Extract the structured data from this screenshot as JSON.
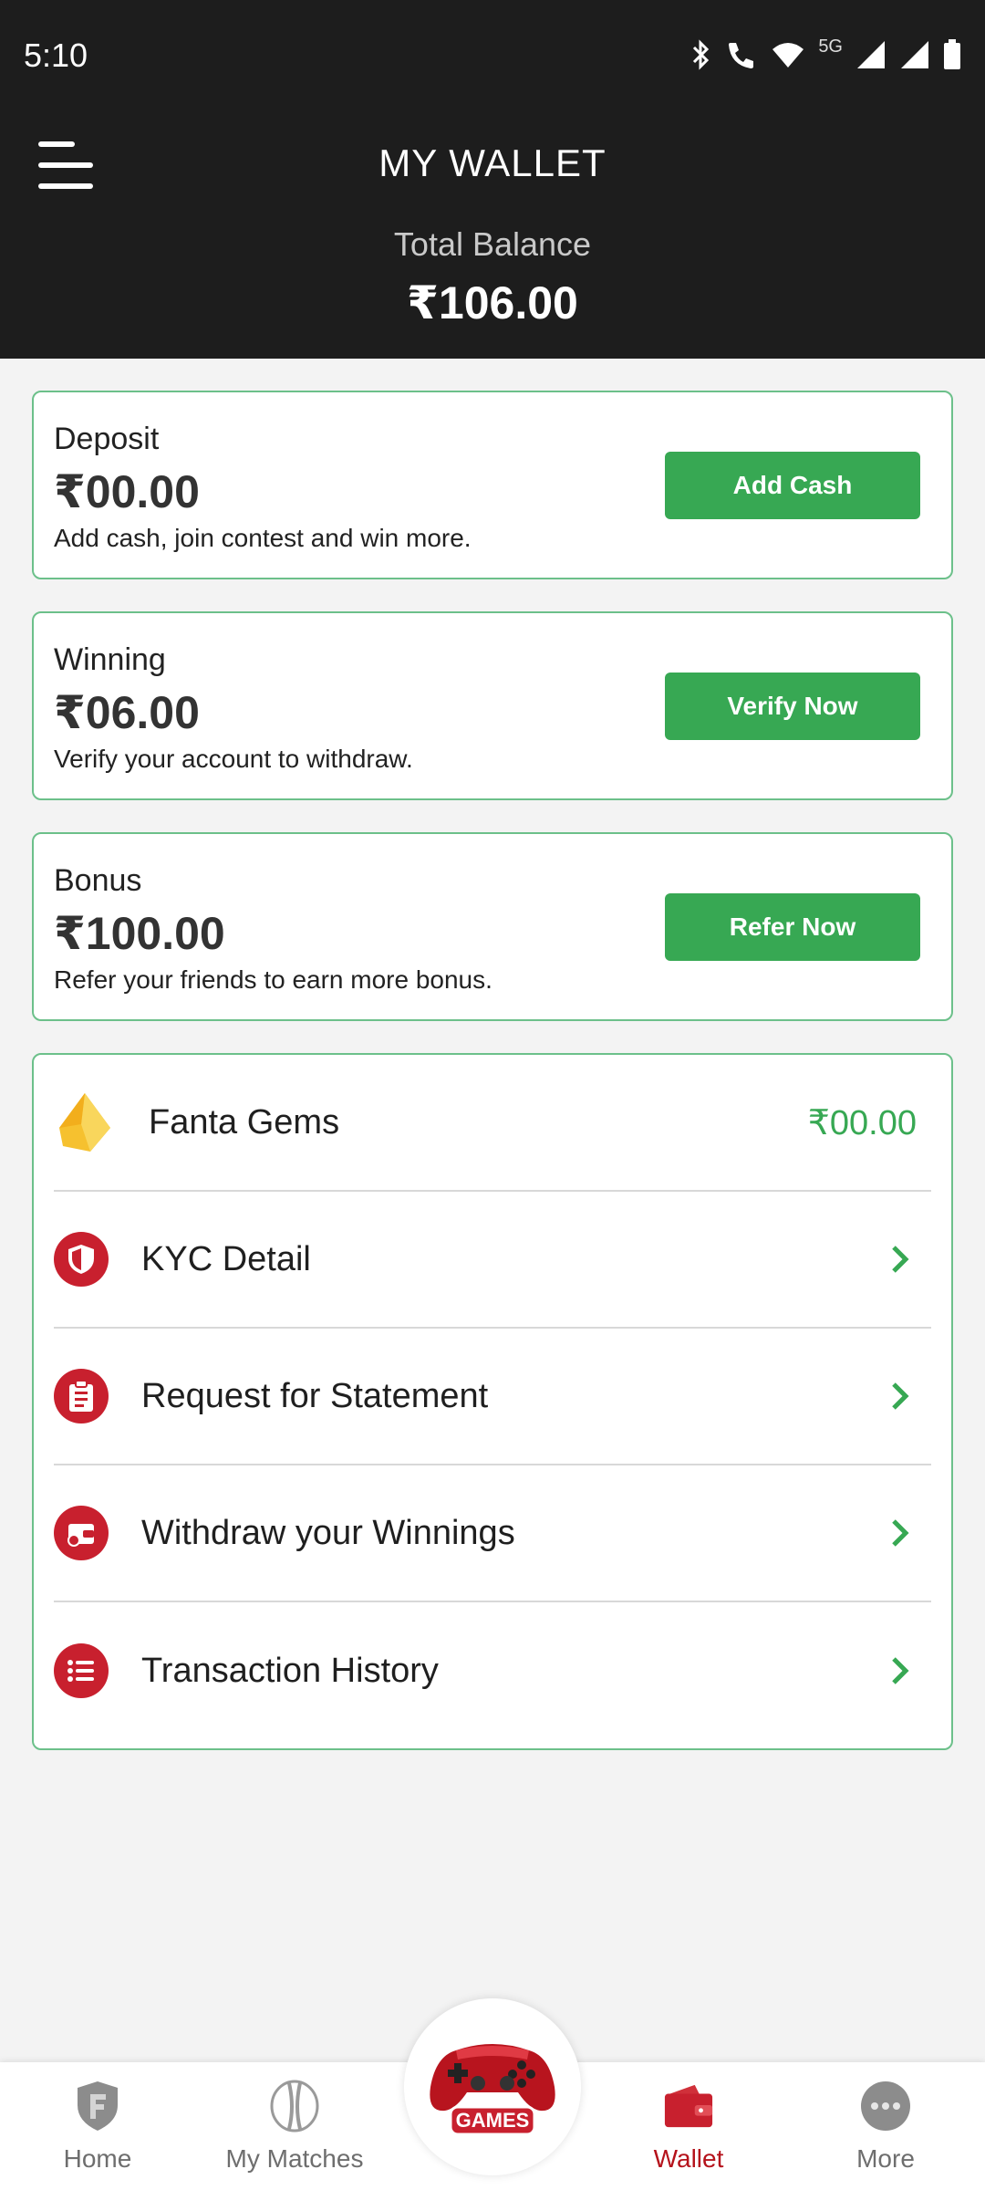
{
  "status_bar": {
    "time": "5:10",
    "network": "5G"
  },
  "header": {
    "title": "MY WALLET",
    "balance_label": "Total Balance",
    "balance_value": "₹106.00"
  },
  "cards": {
    "deposit": {
      "label": "Deposit",
      "amount": "₹00.00",
      "desc": "Add cash, join contest and win more.",
      "button": "Add Cash"
    },
    "winning": {
      "label": "Winning",
      "amount": "₹06.00",
      "desc": "Verify your account to withdraw.",
      "button": "Verify Now"
    },
    "bonus": {
      "label": "Bonus",
      "amount": "₹100.00",
      "desc": "Refer your friends to earn more bonus.",
      "button": "Refer Now"
    }
  },
  "menu": {
    "gems": {
      "label": "Fanta Gems",
      "value": "₹00.00",
      "icon": "gem-icon"
    },
    "items": [
      {
        "label": "KYC Detail",
        "icon": "shield-icon"
      },
      {
        "label": "Request for Statement",
        "icon": "clipboard-icon"
      },
      {
        "label": "Withdraw your Winnings",
        "icon": "wallet-icon"
      },
      {
        "label": "Transaction History",
        "icon": "list-icon"
      }
    ]
  },
  "bottom_nav": {
    "home": "Home",
    "matches": "My Matches",
    "games": "GAMES",
    "wallet": "Wallet",
    "more": "More"
  },
  "colors": {
    "accent": "#37a853",
    "brand": "#c8202e",
    "header_bg": "#1d1d1d",
    "card_border": "#6cc08a"
  }
}
